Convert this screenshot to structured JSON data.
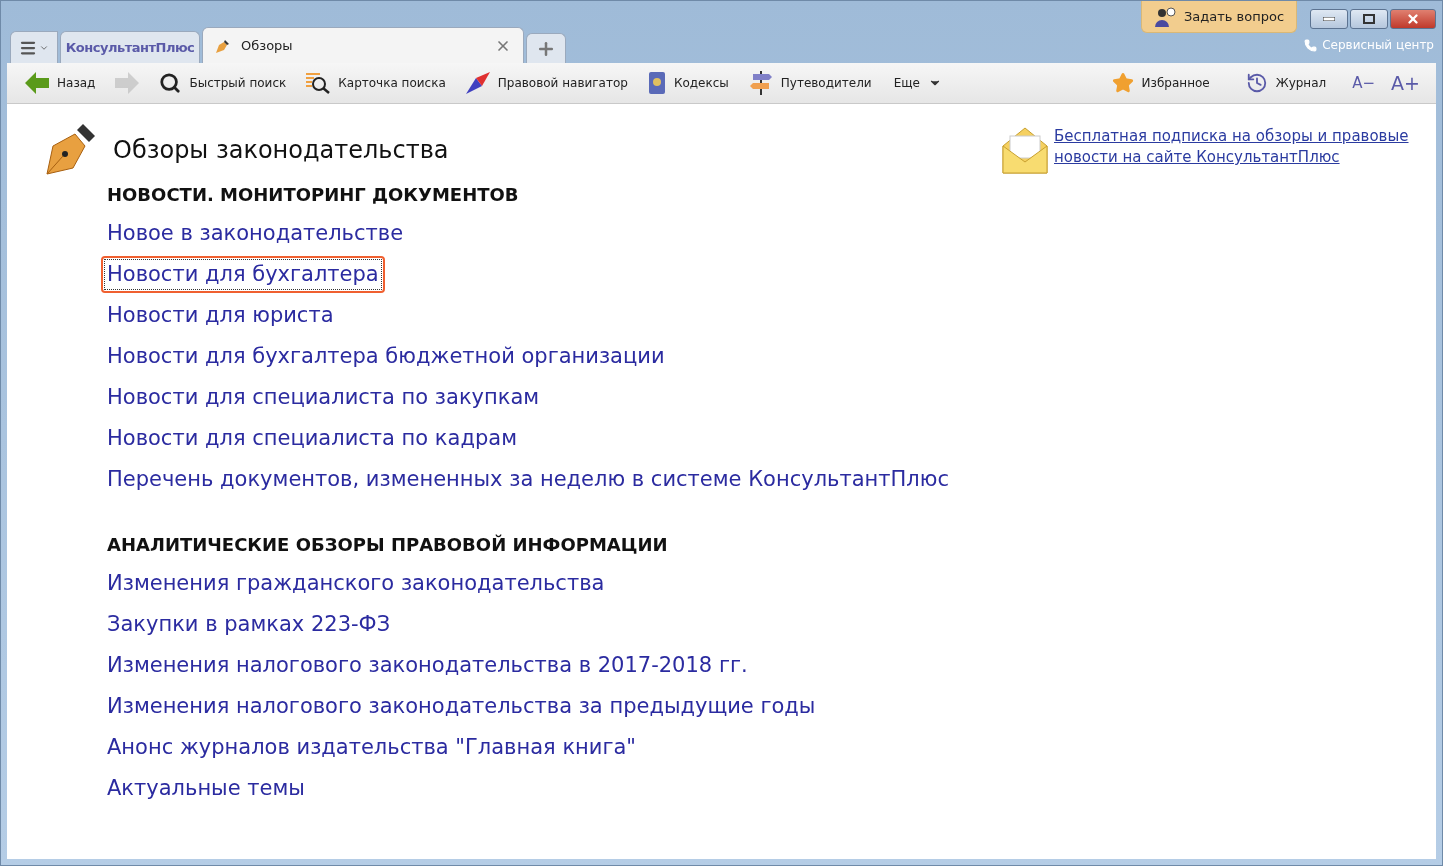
{
  "tabs": [
    {
      "kind": "brand",
      "label": "КонсультантПлюс",
      "selected": false
    },
    {
      "kind": "page",
      "label": "Обзоры",
      "selected": true
    }
  ],
  "ask_button": "Задать вопрос",
  "service_center": "Сервисный центр",
  "toolbar": {
    "left": [
      {
        "kind": "back",
        "label": "Назад",
        "disabled": false
      },
      {
        "kind": "forward",
        "disabled": true
      },
      {
        "kind": "search",
        "label": "Быстрый поиск",
        "disabled": false
      },
      {
        "kind": "card",
        "label": "Карточка поиска",
        "disabled": false
      },
      {
        "kind": "navigator",
        "label": "Правовой навигатор",
        "disabled": false
      },
      {
        "kind": "codes",
        "label": "Кодексы",
        "disabled": false
      },
      {
        "kind": "guides",
        "label": "Путеводители",
        "disabled": false
      },
      {
        "kind": "more",
        "label": "Еще",
        "disabled": false
      }
    ],
    "right": [
      {
        "kind": "favorites",
        "label": "Избранное"
      },
      {
        "kind": "history",
        "label": "Журнал"
      },
      {
        "kind": "smaller",
        "label": "A−"
      },
      {
        "kind": "larger",
        "label": "A+"
      }
    ]
  },
  "page_title": "Обзоры законодательства",
  "subscribe_link": "Бесплатная подписка на обзоры и правовые новости на сайте КонсультантПлюс",
  "sections": [
    {
      "heading": "НОВОСТИ. МОНИТОРИНГ ДОКУМЕНТОВ",
      "links": [
        {
          "label": "Новое в законодательстве",
          "selected": false
        },
        {
          "label": "Новости для бухгалтера",
          "selected": true
        },
        {
          "label": "Новости для юриста",
          "selected": false
        },
        {
          "label": "Новости для бухгалтера бюджетной организации",
          "selected": false
        },
        {
          "label": "Новости для специалиста по закупкам",
          "selected": false
        },
        {
          "label": "Новости для специалиста по кадрам",
          "selected": false
        },
        {
          "label": "Перечень документов, измененных за неделю в системе КонсультантПлюс",
          "selected": false
        }
      ]
    },
    {
      "heading": "АНАЛИТИЧЕСКИЕ ОБЗОРЫ ПРАВОВОЙ ИНФОРМАЦИИ",
      "links": [
        {
          "label": "Изменения гражданского законодательства",
          "selected": false
        },
        {
          "label": "Закупки в рамках 223-ФЗ",
          "selected": false
        },
        {
          "label": "Изменения налогового законодательства в 2017-2018 гг.",
          "selected": false
        },
        {
          "label": "Изменения налогового законодательства за предыдущие годы",
          "selected": false
        },
        {
          "label": "Анонс журналов издательства \"Главная книга\"",
          "selected": false
        },
        {
          "label": "Актуальные темы",
          "selected": false
        }
      ]
    }
  ]
}
